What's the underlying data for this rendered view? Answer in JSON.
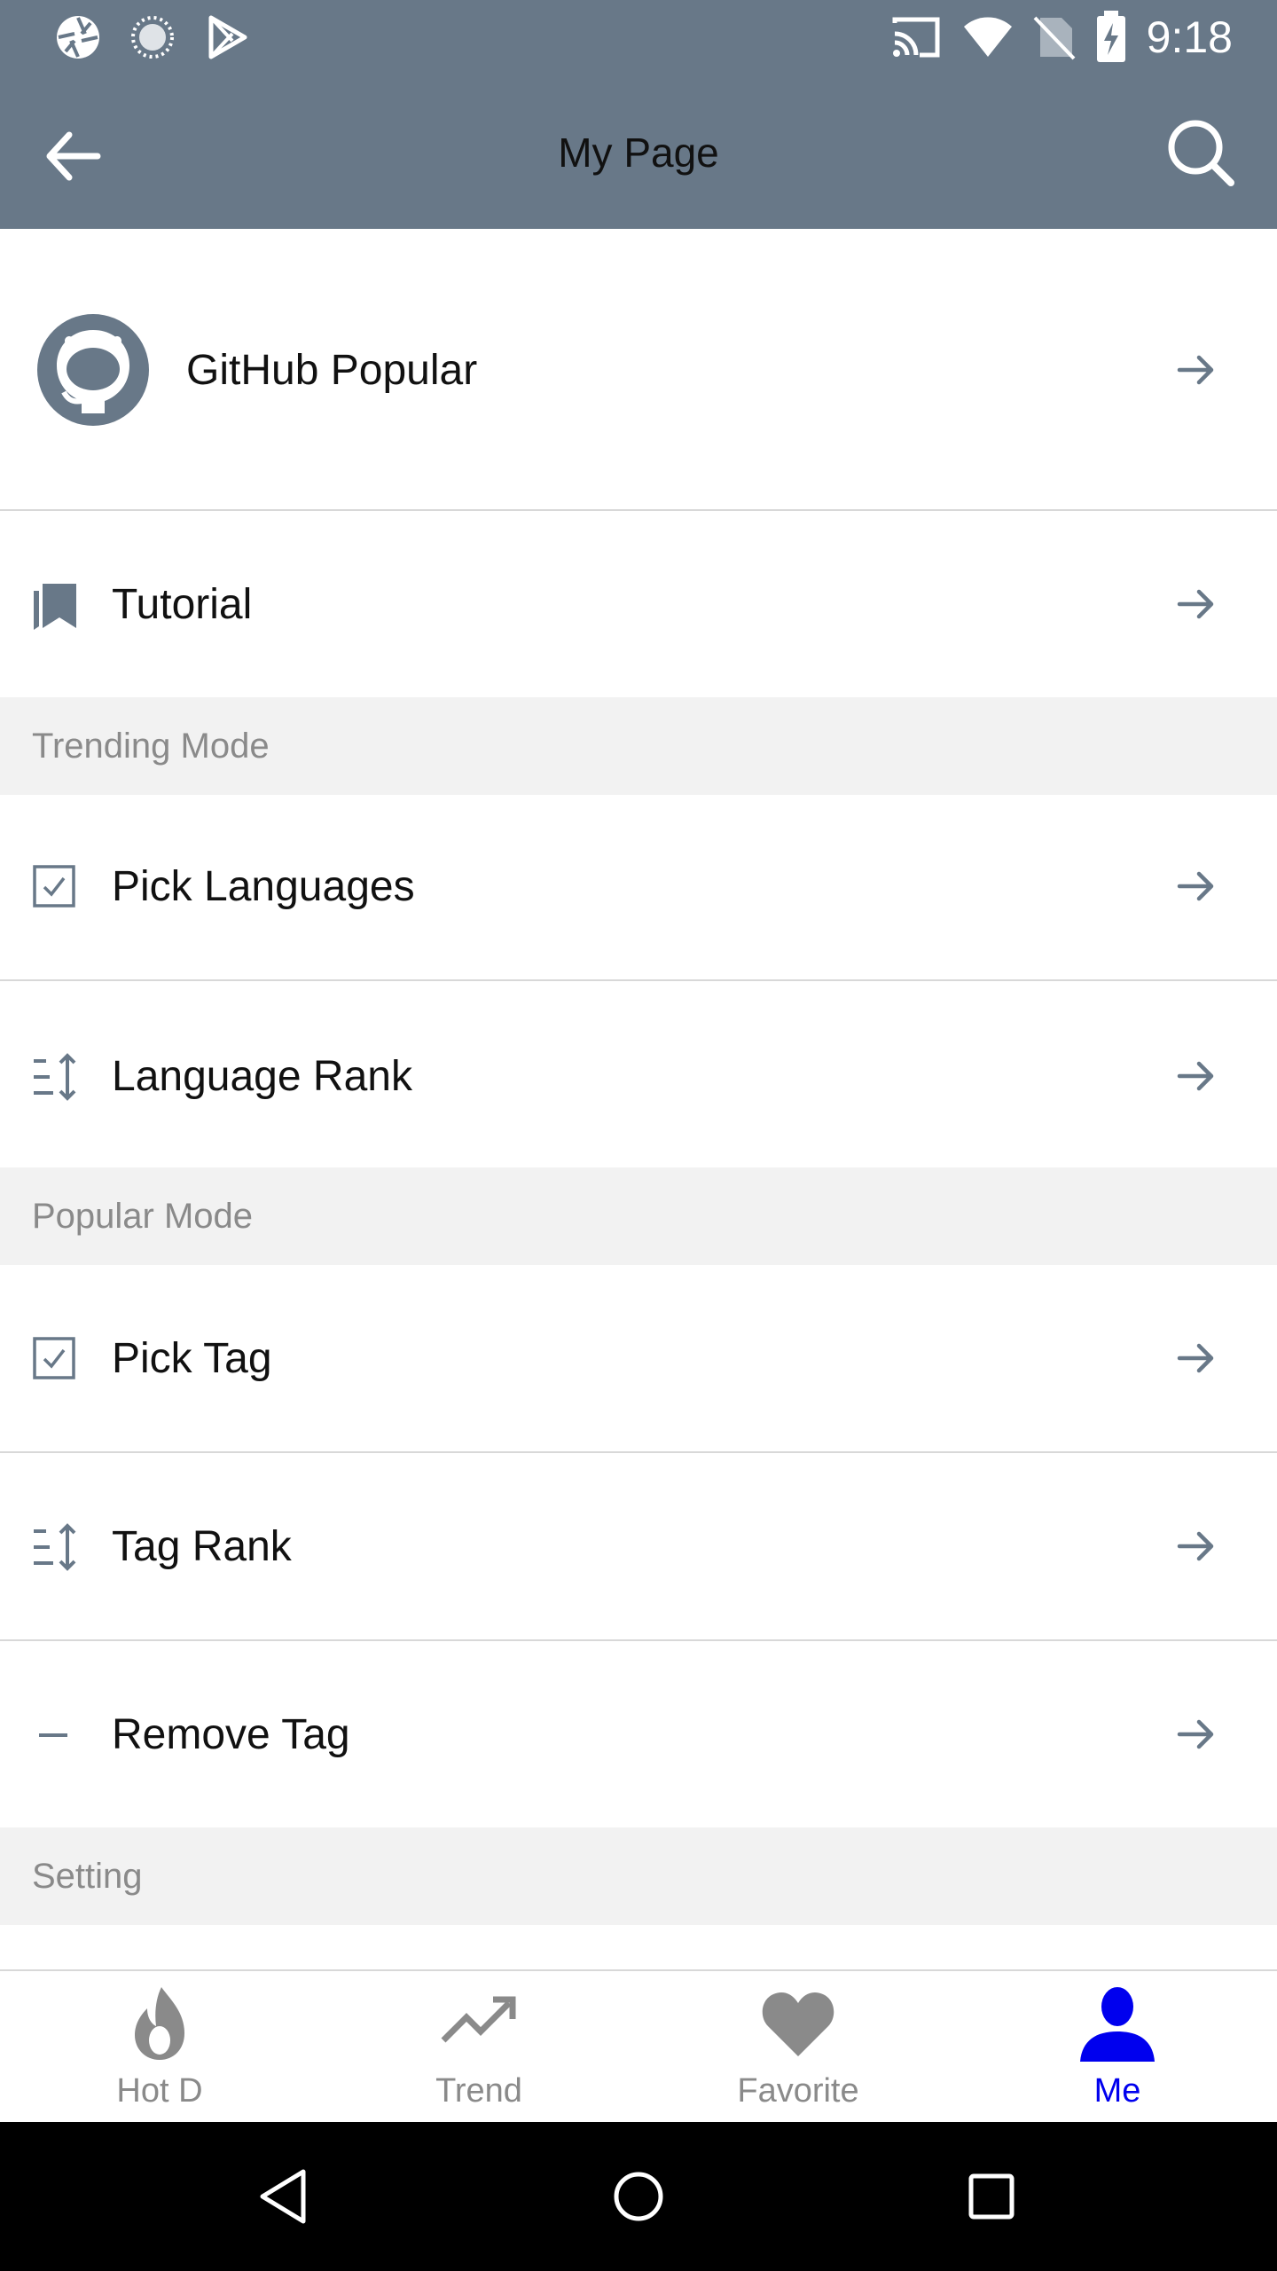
{
  "status_bar": {
    "time": "9:18",
    "left_icons": [
      "aperture-icon",
      "loading-icon",
      "play-store-icon"
    ],
    "right_icons": [
      "cast-icon",
      "wifi-icon",
      "no-sim-icon",
      "battery-charging-icon"
    ]
  },
  "app_bar": {
    "title": "My Page",
    "back_icon": "arrow-left-icon",
    "search_icon": "search-icon"
  },
  "profile": {
    "label": "GitHub Popular",
    "icon": "github-icon"
  },
  "rows": {
    "tutorial": {
      "label": "Tutorial",
      "icon": "bookmark-icon"
    },
    "pick_languages": {
      "label": "Pick Languages",
      "icon": "checkbox-icon"
    },
    "language_rank": {
      "label": "Language Rank",
      "icon": "sort-icon"
    },
    "pick_tag": {
      "label": "Pick Tag",
      "icon": "checkbox-icon"
    },
    "tag_rank": {
      "label": "Tag Rank",
      "icon": "sort-icon"
    },
    "remove_tag": {
      "label": "Remove Tag",
      "icon": "minus-icon"
    }
  },
  "sections": {
    "trending": "Trending Mode",
    "popular": "Popular Mode",
    "setting": "Setting"
  },
  "tabs": [
    {
      "label": "Hot D",
      "icon": "flame-icon",
      "active": false
    },
    {
      "label": "Trend",
      "icon": "trending-up-icon",
      "active": false
    },
    {
      "label": "Favorite",
      "icon": "heart-icon",
      "active": false
    },
    {
      "label": "Me",
      "icon": "person-icon",
      "active": true
    }
  ],
  "colors": {
    "header": "#687888",
    "icon": "#687888",
    "active_tab": "#0000ee",
    "inactive_tab": "#8a8a8a",
    "section_bg": "#f2f2f2"
  },
  "nav_bar": [
    "back-triangle-icon",
    "home-circle-icon",
    "recents-square-icon"
  ]
}
